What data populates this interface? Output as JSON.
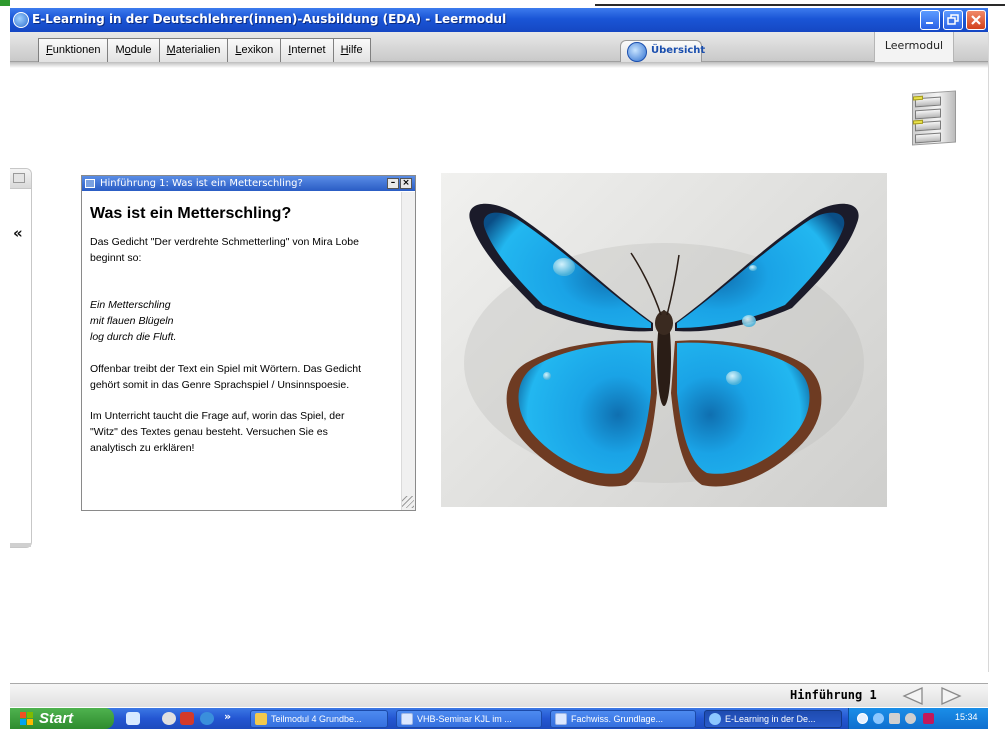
{
  "window": {
    "title": "E-Learning in der Deutschlehrer(innen)-Ausbildung (EDA) - Leermodul"
  },
  "menu": {
    "items": [
      {
        "pre": "",
        "u": "F",
        "post": "unktionen"
      },
      {
        "pre": "M",
        "u": "o",
        "post": "dule"
      },
      {
        "pre": "",
        "u": "M",
        "post": "aterialien"
      },
      {
        "pre": "",
        "u": "L",
        "post": "exikon"
      },
      {
        "pre": "",
        "u": "I",
        "post": "nternet"
      },
      {
        "pre": "",
        "u": "H",
        "post": "ilfe"
      }
    ],
    "overview_label": "Übersicht",
    "module_label": "Leermodul"
  },
  "textwin": {
    "title": "Hinführung 1: Was ist ein Metterschling?",
    "heading": "Was ist ein Metterschling?",
    "intro_line1": "Das Gedicht \"Der verdrehte Schmetterling\" von Mira Lobe",
    "intro_line2": "beginnt so:",
    "poem": [
      "Ein Metterschling",
      "mit flauen Blügeln",
      "log durch die Fluft."
    ],
    "para2_lines": [
      "Offenbar treibt der Text ein Spiel mit Wörtern. Das Gedicht",
      "gehört somit in das Genre Sprachspiel / Unsinnspoesie."
    ],
    "para3_lines": [
      "Im Unterricht taucht die Frage auf, worin das Spiel, der",
      "\"Witz\" des Textes genau besteht. Versuchen Sie es",
      "analytisch zu erklären!"
    ]
  },
  "sidepanel": {
    "collapse_glyph": "«"
  },
  "bottom": {
    "page_label": "Hinführung 1"
  },
  "taskbar": {
    "start_label": "Start",
    "more_glyph": "»",
    "buttons": [
      "Teilmodul 4 Grundbe...",
      "VHB-Seminar KJL im ...",
      "Fachwiss. Grundlage...",
      "E-Learning in der De..."
    ],
    "clock": "15:34"
  },
  "colors": {
    "titlebar": "#1a55d6",
    "taskbar": "#2456d2",
    "start": "#3a9d3a",
    "butterfly": "#1aa8e8"
  }
}
